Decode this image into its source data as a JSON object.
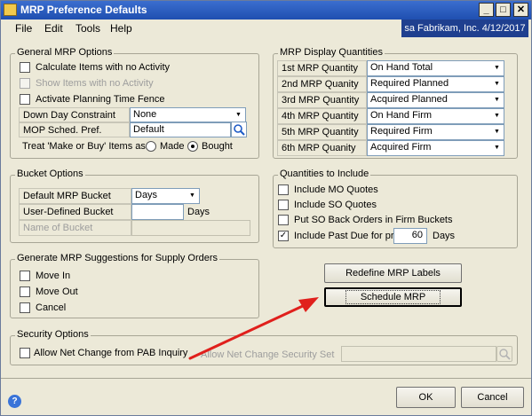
{
  "window": {
    "title": "MRP Preference Defaults",
    "company_info": "sa  Fabrikam, Inc.  4/12/2017",
    "minimize": "_",
    "maximize": "□",
    "close": "✕"
  },
  "menu": [
    "File",
    "Edit",
    "Tools",
    "Help"
  ],
  "general": {
    "title": "General MRP Options",
    "calculate_items": "Calculate Items with no Activity",
    "show_items": "Show Items with no Activity",
    "planning_fence": "Activate Planning Time Fence",
    "down_day_label": "Down Day Constraint",
    "down_day_value": "None",
    "mop_label": "MOP Sched. Pref.",
    "mop_value": "Default",
    "treat_label": "Treat 'Make or Buy' Items as:",
    "made": "Made",
    "bought": "Bought"
  },
  "display": {
    "title": "MRP Display Quantities",
    "rows": [
      {
        "label": "1st MRP Quantity",
        "value": "On Hand Total"
      },
      {
        "label": "2nd MRP Quanity",
        "value": "Required Planned"
      },
      {
        "label": "3rd MRP Quantity",
        "value": "Acquired Planned"
      },
      {
        "label": "4th MRP Quantity",
        "value": "On Hand Firm"
      },
      {
        "label": "5th MRP Quantity",
        "value": "Required Firm"
      },
      {
        "label": "6th MRP Quanity",
        "value": "Acquired Firm"
      }
    ]
  },
  "bucket": {
    "title": "Bucket Options",
    "default_label": "Default MRP Bucket",
    "default_value": "Days",
    "user_label": "User-Defined Bucket Size",
    "user_value": "",
    "days": "Days",
    "name_label": "Name of Bucket"
  },
  "quantities": {
    "title": "Quantities to Include",
    "mo_quotes": "Include MO Quotes",
    "so_quotes": "Include SO Quotes",
    "back_orders": "Put SO Back Orders in Firm Buckets",
    "past_due": "Include Past Due for prior",
    "past_due_value": "60",
    "days": "Days"
  },
  "suggestions": {
    "title": "Generate MRP Suggestions for Supply Orders",
    "move_in": "Move In",
    "move_out": "Move Out",
    "cancel": "Cancel"
  },
  "buttons": {
    "redefine": "Redefine MRP Labels",
    "schedule": "Schedule MRP",
    "ok": "OK",
    "cancel": "Cancel"
  },
  "security": {
    "title": "Security Options",
    "allow_net_change": "Allow Net Change from PAB Inquiry",
    "security_set": "Allow Net Change Security Set"
  },
  "colors": {
    "annotation_arrow": "#e0201c"
  }
}
